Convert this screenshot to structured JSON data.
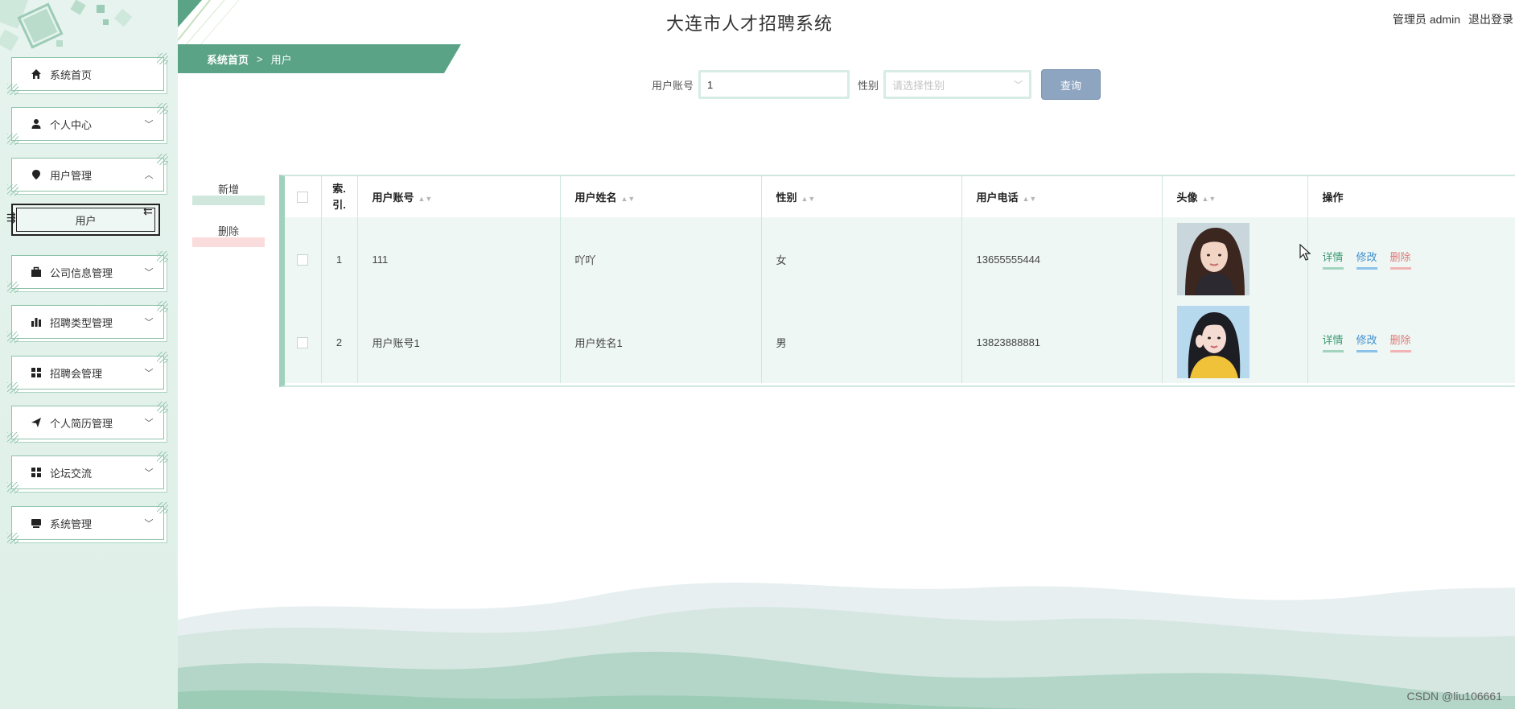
{
  "app": {
    "title": "大连市人才招聘系统"
  },
  "user": {
    "role": "管理员",
    "name": "admin",
    "logout": "退出登录"
  },
  "breadcrumb": {
    "home": "系统首页",
    "separator": ">",
    "current": "用户"
  },
  "sidebar": {
    "items": [
      {
        "label": "系统首页",
        "icon": "home-icon",
        "arrow": ""
      },
      {
        "label": "个人中心",
        "icon": "person-icon",
        "arrow": "﹀"
      },
      {
        "label": "用户管理",
        "icon": "map-pin-icon",
        "arrow": "︿"
      },
      {
        "label": "公司信息管理",
        "icon": "briefcase-icon",
        "arrow": "﹀"
      },
      {
        "label": "招聘类型管理",
        "icon": "bar-chart-icon",
        "arrow": "﹀"
      },
      {
        "label": "招聘会管理",
        "icon": "grid-icon",
        "arrow": "﹀"
      },
      {
        "label": "个人简历管理",
        "icon": "paper-plane-icon",
        "arrow": "﹀"
      },
      {
        "label": "论坛交流",
        "icon": "grid-icon",
        "arrow": "﹀"
      },
      {
        "label": "系统管理",
        "icon": "monitor-icon",
        "arrow": "﹀"
      }
    ],
    "sub_item": "用户"
  },
  "search": {
    "account_label": "用户账号",
    "account_value": "1",
    "gender_label": "性别",
    "gender_placeholder": "请选择性别",
    "query_button": "查询"
  },
  "actions": {
    "add": "新增",
    "delete": "删除"
  },
  "table": {
    "headers": [
      "索引",
      "用户账号",
      "用户姓名",
      "性别",
      "用户电话",
      "头像",
      "操作"
    ],
    "index_header_line1": "索.",
    "index_header_line2": "引.",
    "rows": [
      {
        "index": "1",
        "account": "111",
        "name": "吖吖",
        "gender": "女",
        "phone": "13655555444"
      },
      {
        "index": "2",
        "account": "用户账号1",
        "name": "用户姓名1",
        "gender": "男",
        "phone": "13823888881"
      }
    ],
    "ops": {
      "detail": "详情",
      "edit": "修改",
      "delete": "删除"
    }
  },
  "watermark": "CSDN @liu106661",
  "colors": {
    "accent": "#5aa386",
    "sidebar_bg": "#e6f3ee",
    "query_btn": "#8ea5c1",
    "detail": "#3f9a74",
    "edit": "#3f8fcf",
    "delete": "#e07a7a"
  }
}
